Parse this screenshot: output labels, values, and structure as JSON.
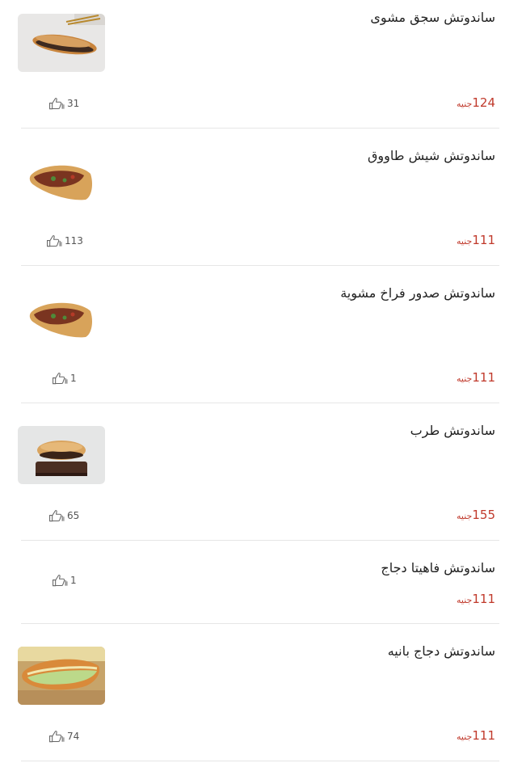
{
  "currency": "جنيه",
  "items": [
    {
      "name": "ساندوتش سجق مشوى",
      "price": "124",
      "likes": "31",
      "image": "sausage-sandwich-photo"
    },
    {
      "name": "ساندوتش شيش طاووق",
      "price": "111",
      "likes": "113",
      "image": "pita-sandwich-photo"
    },
    {
      "name": "ساندوتش صدور فراخ مشوية",
      "price": "111",
      "likes": "1",
      "image": "pita-sandwich-photo"
    },
    {
      "name": "ساندوتش طرب",
      "price": "155",
      "likes": "65",
      "image": "sandwich-on-board-photo"
    },
    {
      "name": "ساندوتش فاهيتا دجاج",
      "price": "111",
      "likes": "1",
      "image": ""
    },
    {
      "name": "ساندوتش دجاج بانيه",
      "price": "111",
      "likes": "74",
      "image": "panne-sandwich-photo"
    }
  ]
}
